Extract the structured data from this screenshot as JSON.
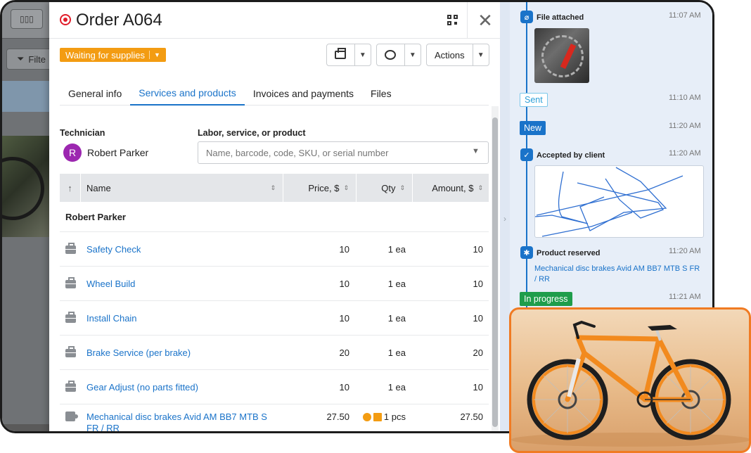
{
  "background": {
    "filter_label": "Filte"
  },
  "order": {
    "title": "Order A064",
    "status": "Waiting for supplies",
    "actions_label": "Actions"
  },
  "tabs": [
    "General info",
    "Services and products",
    "Invoices and payments",
    "Files"
  ],
  "technician": {
    "label": "Technician",
    "initial": "R",
    "name": "Robert Parker"
  },
  "product_search": {
    "label": "Labor, service, or product",
    "placeholder": "Name, barcode, code, SKU, or serial number"
  },
  "table": {
    "columns": [
      "Name",
      "Price, $",
      "Qty",
      "Amount, $"
    ],
    "group": "Robert Parker",
    "rows": [
      {
        "name": "Safety Check",
        "price": "10",
        "qty": "1 ea",
        "amount": "10",
        "kind": "service"
      },
      {
        "name": "Wheel Build",
        "price": "10",
        "qty": "1 ea",
        "amount": "10",
        "kind": "service"
      },
      {
        "name": "Install Chain",
        "price": "10",
        "qty": "1 ea",
        "amount": "10",
        "kind": "service"
      },
      {
        "name": "Brake Service (per brake)",
        "price": "20",
        "qty": "1 ea",
        "amount": "20",
        "kind": "service"
      },
      {
        "name": "Gear Adjust (no parts fitted)",
        "price": "10",
        "qty": "1 ea",
        "amount": "10",
        "kind": "service"
      },
      {
        "name": "Mechanical disc brakes Avid AM BB7 MTB S FR / RR",
        "price": "27.50",
        "qty": "1 pcs",
        "amount": "27.50",
        "kind": "product"
      }
    ]
  },
  "timeline": {
    "file_attached": {
      "title": "File attached",
      "time": "11:07 AM"
    },
    "sent": {
      "label": "Sent",
      "time": "11:10 AM"
    },
    "new": {
      "label": "New",
      "time": "11:20 AM"
    },
    "accepted": {
      "title": "Accepted by client",
      "time": "11:20 AM"
    },
    "reserved": {
      "title": "Product reserved",
      "time": "11:20 AM",
      "link": "Mechanical disc brakes Avid AM BB7 MTB S FR / RR"
    },
    "in_progress": {
      "label": "In progress",
      "time": "11:21 AM"
    }
  },
  "colors": {
    "accent": "#1a73c9",
    "status_orange": "#f39c12",
    "in_progress_green": "#1f9d4b",
    "target_red": "#e11d2a",
    "avatar_purple": "#9c27b0",
    "photo_border": "#f07b23"
  }
}
